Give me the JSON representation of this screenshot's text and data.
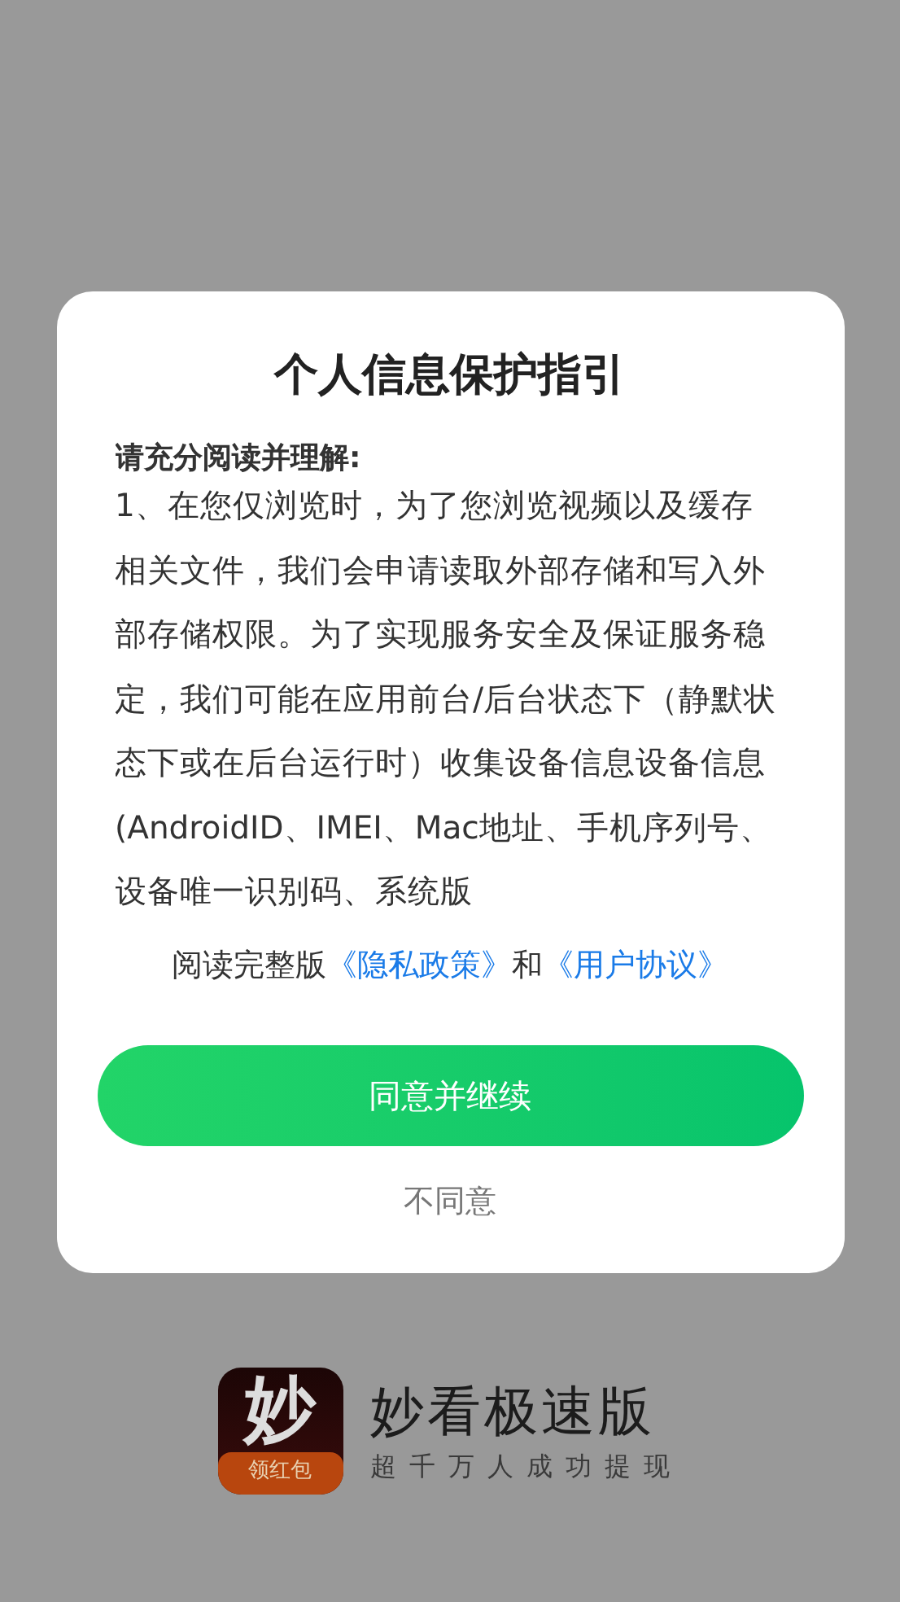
{
  "dialog": {
    "title": "个人信息保护指引",
    "intro": "请充分阅读并理解:",
    "body": "1、在您仅浏览时，为了您浏览视频以及缓存相关文件，我们会申请读取外部存储和写入外部存储权限。为了实现服务安全及保证服务稳定，我们可能在应用前台/后台状态下（静默状态下或在后台运行时）收集设备信息设备信息(AndroidID、IMEI、Mac地址、手机序列号、设备唯一识别码、系统版",
    "notice": [
      {
        "kind": "text",
        "text": "阅读完整版"
      },
      {
        "kind": "link",
        "text": "《隐私政策》"
      },
      {
        "kind": "text",
        "text": "和"
      },
      {
        "kind": "link",
        "text": "《用户协议》"
      }
    ],
    "agree_button": "同意并继续",
    "decline_button": "不同意"
  },
  "app": {
    "icon_glyph": "妙",
    "icon_badge": "领红包",
    "name": "妙看极速版",
    "slogan": "超千万人成功提现"
  }
}
